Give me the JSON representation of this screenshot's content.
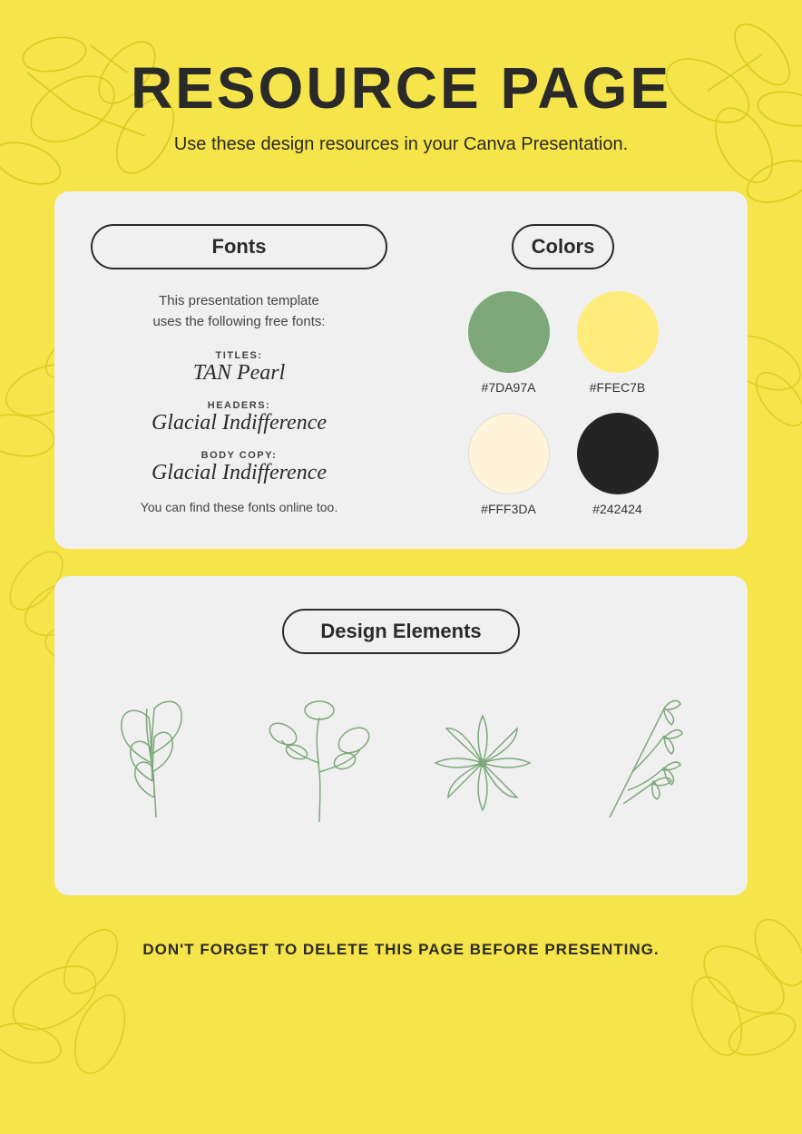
{
  "page": {
    "title": "RESOURCE PAGE",
    "subtitle": "Use these design resources in your Canva Presentation.",
    "background_color": "#F5E44A"
  },
  "fonts_section": {
    "header": "Fonts",
    "description_line1": "This presentation template",
    "description_line2": "uses the following free fonts:",
    "titles_label": "TITLES:",
    "titles_font": "TAN Pearl",
    "headers_label": "HEADERS:",
    "headers_font": "Glacial Indifference",
    "body_label": "BODY COPY:",
    "body_font": "Glacial Indifference",
    "note": "You can find these fonts online too."
  },
  "colors_section": {
    "header": "Colors",
    "swatches": [
      {
        "hex": "#7DA97A",
        "label": "#7DA97A"
      },
      {
        "hex": "#FFEC7B",
        "label": "#FFEC7B"
      },
      {
        "hex": "#FFF3DA",
        "label": "#FFF3DA"
      },
      {
        "hex": "#242424",
        "label": "#242424"
      }
    ]
  },
  "design_elements": {
    "header": "Design Elements"
  },
  "footer": {
    "note": "DON'T FORGET TO DELETE THIS PAGE BEFORE PRESENTING."
  }
}
